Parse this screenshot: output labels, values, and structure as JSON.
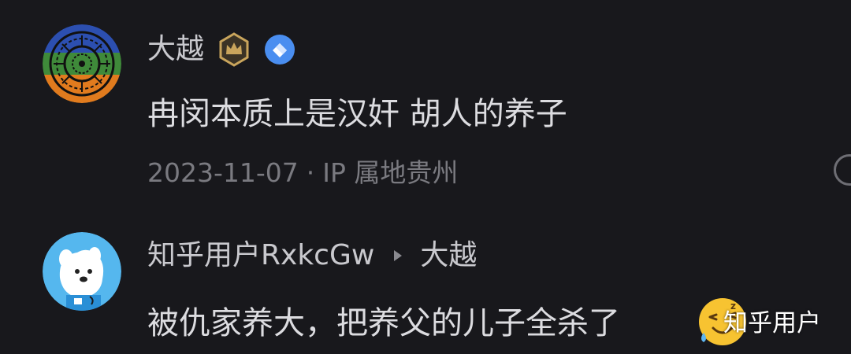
{
  "comments": [
    {
      "author": "大越",
      "badges": [
        "crown-badge-icon",
        "verified-badge-icon"
      ],
      "text": "冉闵本质上是汉奸 胡人的养子",
      "date": "2023-11-07",
      "separator": "·",
      "location": "IP 属地贵州"
    },
    {
      "author": "知乎用户RxkcGw",
      "reply_to": "大越",
      "text": "被仇家养大，把养父的儿子全杀了",
      "emoji": "sleepy-laugh-emoji"
    }
  ],
  "watermark": "知乎用户",
  "colors": {
    "background": "#18181c",
    "author_text": "#c9c9ce",
    "body_text": "#dcdce0",
    "meta_text": "#7a7a80",
    "crown_badge": "#c9a55c",
    "verified_badge": "#4a8ef0",
    "avatar2_bg": "#55b7ee"
  }
}
